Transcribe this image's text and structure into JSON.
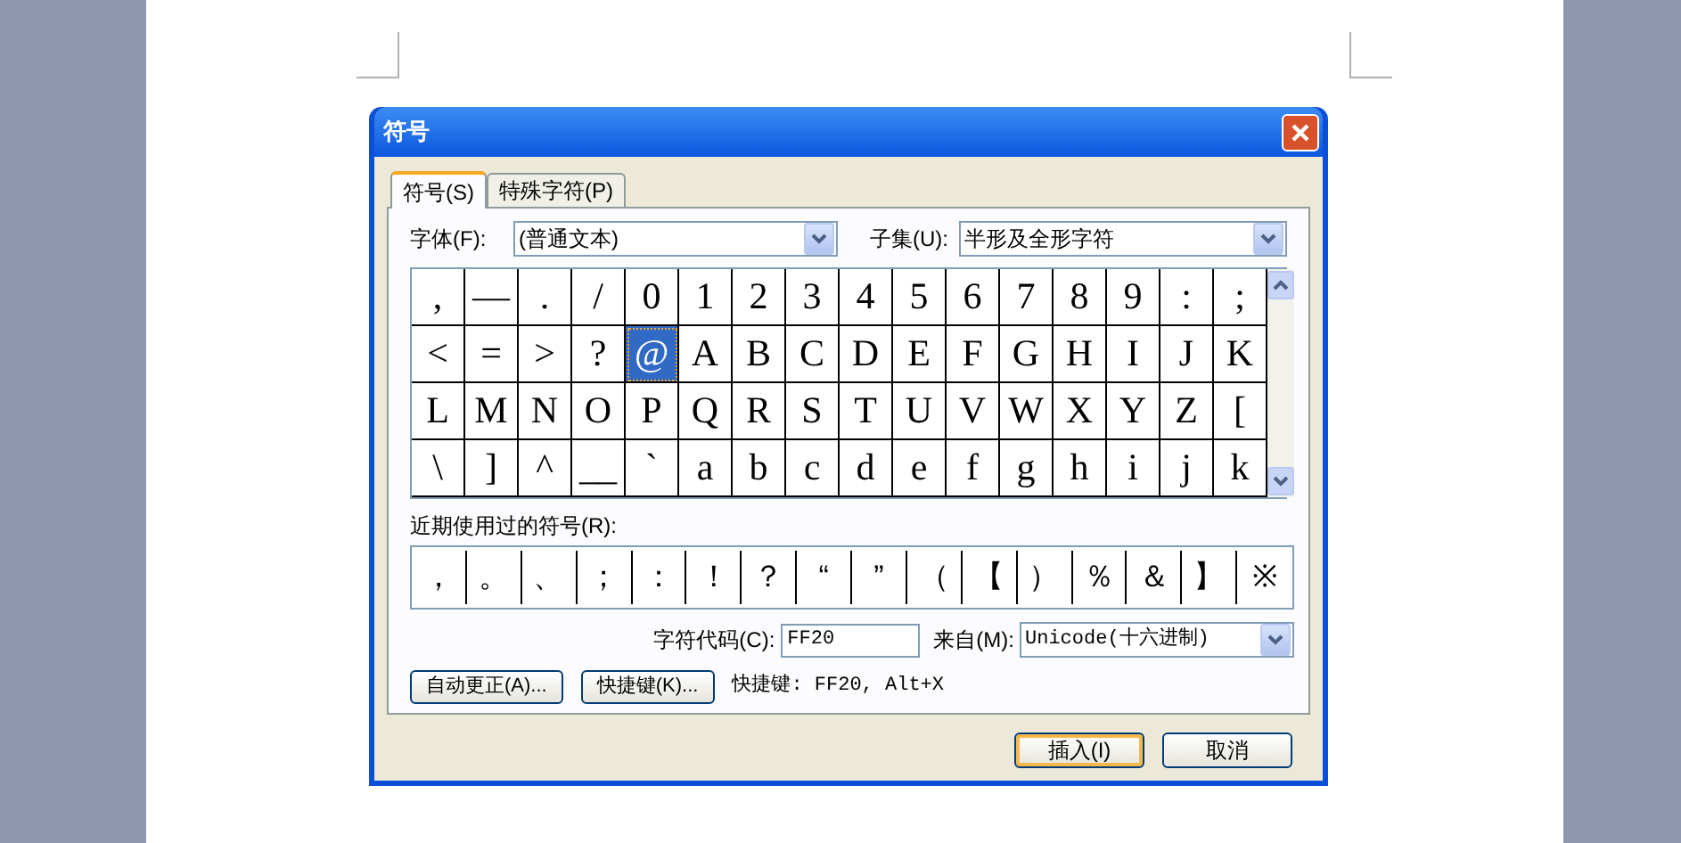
{
  "window": {
    "title": "符号"
  },
  "tabs": [
    {
      "label": "符号(S)",
      "selected": true
    },
    {
      "label": "特殊字符(P)",
      "selected": false
    }
  ],
  "font": {
    "label": "字体(F):",
    "value": "(普通文本)"
  },
  "subset": {
    "label": "子集(U):",
    "value": "半形及全形字符"
  },
  "grid": [
    [
      {
        "char": ",",
        "selected": false
      },
      {
        "char": "—",
        "selected": false
      },
      {
        "char": ".",
        "selected": false
      },
      {
        "char": "/",
        "selected": false
      },
      {
        "char": "0",
        "selected": false
      },
      {
        "char": "1",
        "selected": false
      },
      {
        "char": "2",
        "selected": false
      },
      {
        "char": "3",
        "selected": false
      },
      {
        "char": "4",
        "selected": false
      },
      {
        "char": "5",
        "selected": false
      },
      {
        "char": "6",
        "selected": false
      },
      {
        "char": "7",
        "selected": false
      },
      {
        "char": "8",
        "selected": false
      },
      {
        "char": "9",
        "selected": false
      },
      {
        "char": ":",
        "selected": false
      },
      {
        "char": ";",
        "selected": false
      }
    ],
    [
      {
        "char": "<",
        "selected": false
      },
      {
        "char": "=",
        "selected": false
      },
      {
        "char": ">",
        "selected": false
      },
      {
        "char": "?",
        "selected": false
      },
      {
        "char": "@",
        "selected": true
      },
      {
        "char": "A",
        "selected": false
      },
      {
        "char": "B",
        "selected": false
      },
      {
        "char": "C",
        "selected": false
      },
      {
        "char": "D",
        "selected": false
      },
      {
        "char": "E",
        "selected": false
      },
      {
        "char": "F",
        "selected": false
      },
      {
        "char": "G",
        "selected": false
      },
      {
        "char": "H",
        "selected": false
      },
      {
        "char": "I",
        "selected": false
      },
      {
        "char": "J",
        "selected": false
      },
      {
        "char": "K",
        "selected": false
      }
    ],
    [
      {
        "char": "L",
        "selected": false
      },
      {
        "char": "M",
        "selected": false
      },
      {
        "char": "N",
        "selected": false
      },
      {
        "char": "O",
        "selected": false
      },
      {
        "char": "P",
        "selected": false
      },
      {
        "char": "Q",
        "selected": false
      },
      {
        "char": "R",
        "selected": false
      },
      {
        "char": "S",
        "selected": false
      },
      {
        "char": "T",
        "selected": false
      },
      {
        "char": "U",
        "selected": false
      },
      {
        "char": "V",
        "selected": false
      },
      {
        "char": "W",
        "selected": false
      },
      {
        "char": "X",
        "selected": false
      },
      {
        "char": "Y",
        "selected": false
      },
      {
        "char": "Z",
        "selected": false
      },
      {
        "char": "[",
        "selected": false
      }
    ],
    [
      {
        "char": "\\",
        "selected": false
      },
      {
        "char": "]",
        "selected": false
      },
      {
        "char": "^",
        "selected": false
      },
      {
        "char": "__",
        "selected": false
      },
      {
        "char": "`",
        "selected": false
      },
      {
        "char": "a",
        "selected": false
      },
      {
        "char": "b",
        "selected": false
      },
      {
        "char": "c",
        "selected": false
      },
      {
        "char": "d",
        "selected": false
      },
      {
        "char": "e",
        "selected": false
      },
      {
        "char": "f",
        "selected": false
      },
      {
        "char": "g",
        "selected": false
      },
      {
        "char": "h",
        "selected": false
      },
      {
        "char": "i",
        "selected": false
      },
      {
        "char": "j",
        "selected": false
      },
      {
        "char": "k",
        "selected": false
      }
    ]
  ],
  "recent": {
    "label": "近期使用过的符号(R):",
    "symbols": [
      "，",
      "。",
      "、",
      "；",
      "：",
      "！",
      "？",
      "“",
      "”",
      "（",
      "【",
      "）",
      "％",
      "＆",
      "】",
      "※"
    ]
  },
  "char_code": {
    "label": "字符代码(C):",
    "value": "FF20"
  },
  "from": {
    "label": "来自(M):",
    "value": "Unicode(十六进制)"
  },
  "buttons_row": [
    {
      "label": "自动更正(A)..."
    },
    {
      "label": "快捷键(K)..."
    }
  ],
  "shortcut_text": "快捷键: FF20, Alt+X",
  "footer_buttons": [
    {
      "label": "插入(I)",
      "kind": "default"
    },
    {
      "label": "取消",
      "kind": "normal"
    }
  ]
}
